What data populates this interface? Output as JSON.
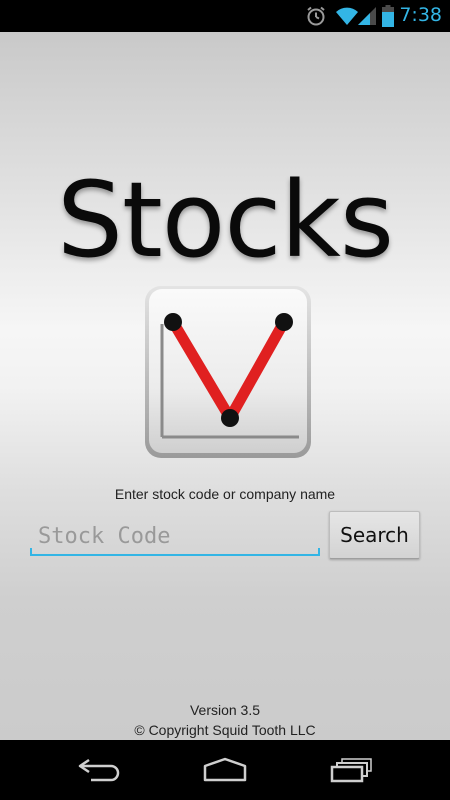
{
  "status_bar": {
    "time": "7:38",
    "icons": [
      "alarm-icon",
      "wifi-icon",
      "signal-icon",
      "battery-icon"
    ],
    "accent_color": "#33b5e5"
  },
  "app": {
    "title": "Stocks",
    "logo_icon": "stock-chart-logo-icon"
  },
  "search": {
    "prompt_label": "Enter stock code or company name",
    "input_value": "",
    "input_placeholder": "Stock Code",
    "button_label": "Search"
  },
  "footer": {
    "version": "Version 3.5",
    "copyright": "© Copyright Squid Tooth LLC"
  },
  "nav_bar": {
    "buttons": [
      "back-icon",
      "home-icon",
      "recent-apps-icon"
    ]
  },
  "colors": {
    "accent": "#33b5e5",
    "logo_line": "#e02020",
    "system_bar": "#000000"
  }
}
